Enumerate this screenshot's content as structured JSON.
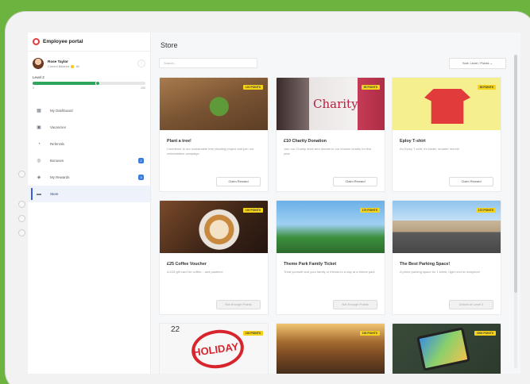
{
  "app": {
    "name": "Employee portal"
  },
  "user": {
    "name": "Rose Taylor",
    "balance_label": "Current Balance",
    "balance": "46"
  },
  "level": {
    "label": "Level 2",
    "min": "0",
    "max": "250",
    "progress": 0.58
  },
  "nav": [
    {
      "label": "My Dashboard",
      "icon": "dashboard-icon",
      "glyph": "▦",
      "active": false,
      "badge": ""
    },
    {
      "label": "Vacancies",
      "icon": "vacancies-icon",
      "glyph": "▣",
      "active": false,
      "badge": ""
    },
    {
      "label": "Referrals",
      "icon": "referrals-icon",
      "glyph": "◔",
      "active": false,
      "badge": ""
    },
    {
      "label": "Bonuses",
      "icon": "bonuses-icon",
      "glyph": "◎",
      "active": false,
      "badge": "2"
    },
    {
      "label": "My Rewards",
      "icon": "rewards-icon",
      "glyph": "◈",
      "active": false,
      "badge": "3"
    },
    {
      "label": "Store",
      "icon": "store-icon",
      "glyph": "▬",
      "active": true,
      "badge": ""
    }
  ],
  "store": {
    "title": "Store",
    "search_placeholder": "Search...",
    "sort_label": "Sort: Level / Points ⌄"
  },
  "cards": [
    {
      "title": "Plant a tree!",
      "desc": "Contribute to our sustainable tree planting project and join our reforestation campaign",
      "points": "120 POINTS",
      "button": "Claim Reward",
      "disabled": false,
      "image": "plant-image"
    },
    {
      "title": "£10 Charity Donation",
      "desc": "Join our Charity drive and donate to our chosen charity for this year",
      "points": "95 POINTS",
      "button": "Claim Reward",
      "disabled": false,
      "image": "charity-image"
    },
    {
      "title": "Eploy T-shirt",
      "desc": "An Eploy T-shirt, it's faster, smarter merch!",
      "points": "95 POINTS",
      "button": "Claim Reward",
      "disabled": false,
      "image": "tshirt-image"
    },
    {
      "title": "£25 Coffee Voucher",
      "desc": "A £25 gift card for coffee... and pastries!",
      "points": "130 POINTS",
      "button": "Not Enough Points",
      "disabled": true,
      "image": "coffee-image"
    },
    {
      "title": "Theme Park Family Ticket",
      "desc": "Treat yourself and your family or friends to a day at a theme park",
      "points": "170 POINTS",
      "button": "Not Enough Points",
      "disabled": true,
      "image": "themepark-image"
    },
    {
      "title": "The Best Parking Space!",
      "desc": "A prime parking space for 1 week, right next to reception!",
      "points": "170 POINTS",
      "button": "Unlock at Level 3",
      "disabled": true,
      "image": "parking-image"
    },
    {
      "title": "",
      "desc": "",
      "points": "130 POINTS",
      "button": "",
      "disabled": false,
      "image": "holiday-image",
      "img_text": "HOLIDAY",
      "img_num": "22"
    },
    {
      "title": "",
      "desc": "",
      "points": "150 POINTS",
      "button": "",
      "disabled": false,
      "image": "dinner-image"
    },
    {
      "title": "",
      "desc": "",
      "points": "2000 POINTS",
      "button": "",
      "disabled": false,
      "image": "tablet-image"
    }
  ]
}
